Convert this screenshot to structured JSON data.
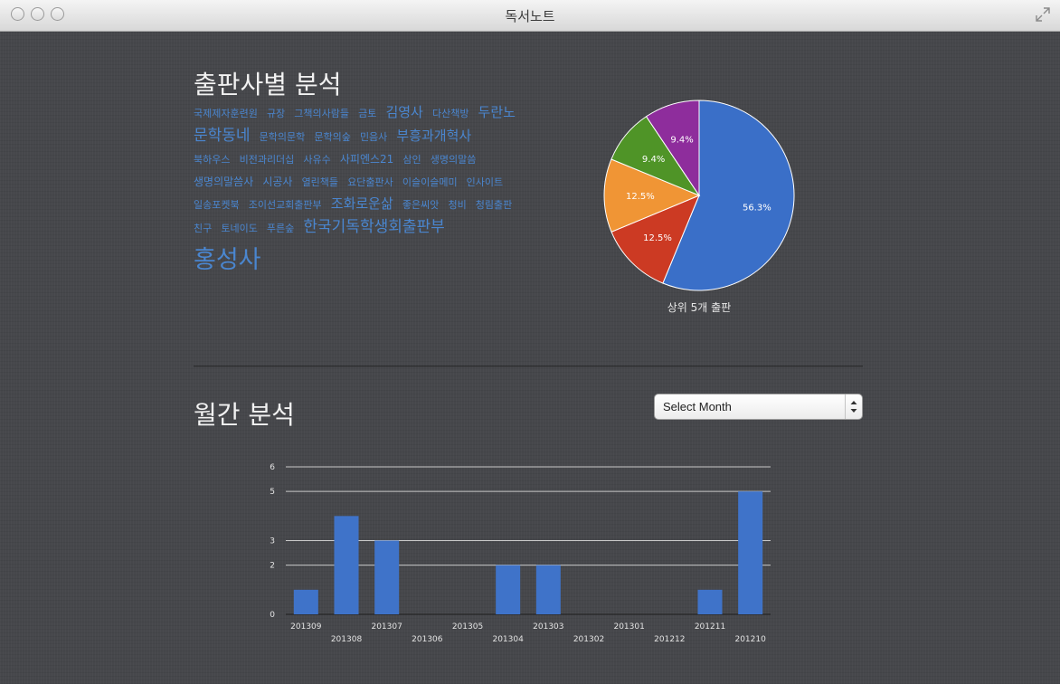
{
  "window": {
    "title": "독서노트"
  },
  "publisher_section": {
    "title": "출판사별 분석",
    "tag_cloud": [
      {
        "text": "국제제자훈련원",
        "size": 1
      },
      {
        "text": "규장",
        "size": 1
      },
      {
        "text": "그책의사람들",
        "size": 1
      },
      {
        "text": "금토",
        "size": 1
      },
      {
        "text": "김영사",
        "size": 3
      },
      {
        "text": "다산책방",
        "size": 1
      },
      {
        "text": "두란노",
        "size": 3
      },
      {
        "text": "문학동네",
        "size": 4
      },
      {
        "text": "문학의문학",
        "size": 1
      },
      {
        "text": "문학의숲",
        "size": 1
      },
      {
        "text": "민음사",
        "size": 1
      },
      {
        "text": "부흥과개혁사",
        "size": 3
      },
      {
        "text": "북하우스",
        "size": 1
      },
      {
        "text": "비전과리더십",
        "size": 1
      },
      {
        "text": "사유수",
        "size": 1
      },
      {
        "text": "사피엔스21",
        "size": 2
      },
      {
        "text": "삼인",
        "size": 1
      },
      {
        "text": "생명의말씀",
        "size": 1
      },
      {
        "text": "생명의말씀사",
        "size": 2
      },
      {
        "text": "시공사",
        "size": 2
      },
      {
        "text": "열린책들",
        "size": 1
      },
      {
        "text": "요단출판사",
        "size": 1
      },
      {
        "text": "이슬이슬메미",
        "size": 1
      },
      {
        "text": "인사이트",
        "size": 1
      },
      {
        "text": "일송포켓북",
        "size": 1
      },
      {
        "text": "조이선교회출판부",
        "size": 1
      },
      {
        "text": "조화로운삶",
        "size": 3
      },
      {
        "text": "좋은씨앗",
        "size": 1
      },
      {
        "text": "청비",
        "size": 1
      },
      {
        "text": "청림출판",
        "size": 1
      },
      {
        "text": "친구",
        "size": 1
      },
      {
        "text": "토네이도",
        "size": 1
      },
      {
        "text": "푸른숲",
        "size": 1
      },
      {
        "text": "한국기독학생회출판부",
        "size": 4
      },
      {
        "text": "홍성사",
        "size": 5
      }
    ],
    "pie_caption": "상위 5개 출판"
  },
  "monthly_section": {
    "title": "월간 분석",
    "select": {
      "value": "Select Month"
    }
  },
  "colors": {
    "cloud_link": "#4a86cf",
    "pie_blue": "#3a6fc8",
    "pie_red": "#cc3a23",
    "pie_orange": "#f09535",
    "pie_green": "#4f9427",
    "pie_purple": "#8e2d9c",
    "bar": "#3f73c9"
  },
  "chart_data": [
    {
      "type": "pie",
      "caption": "상위 5개 출판",
      "slices": [
        {
          "label": "56.3%",
          "value": 56.3,
          "color": "#3a6fc8"
        },
        {
          "label": "12.5%",
          "value": 12.5,
          "color": "#cc3a23"
        },
        {
          "label": "12.5%",
          "value": 12.5,
          "color": "#f09535"
        },
        {
          "label": "9.4%",
          "value": 9.4,
          "color": "#4f9427"
        },
        {
          "label": "9.4%",
          "value": 9.4,
          "color": "#8e2d9c"
        }
      ]
    },
    {
      "type": "bar",
      "categories": [
        "201309",
        "201308",
        "201307",
        "201306",
        "201305",
        "201304",
        "201303",
        "201302",
        "201301",
        "201212",
        "201211",
        "201210"
      ],
      "values": [
        1,
        4,
        3,
        0,
        0,
        2,
        2,
        0,
        0,
        0,
        1,
        5
      ],
      "y_ticks": [
        "0",
        "2",
        "3",
        "5",
        "6"
      ],
      "y_tick_values": [
        0,
        2,
        3,
        5,
        6
      ],
      "ylim": [
        0,
        6
      ],
      "grid": true
    }
  ]
}
